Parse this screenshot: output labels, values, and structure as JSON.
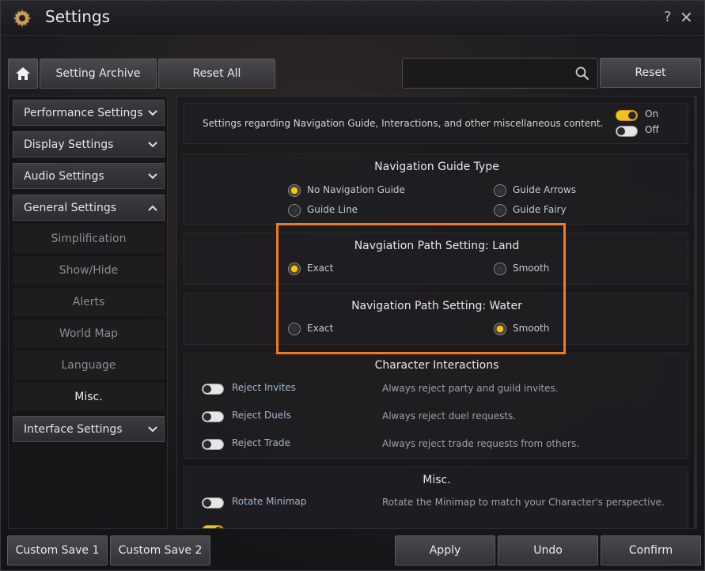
{
  "window": {
    "title": "Settings",
    "help": "?",
    "close": "✕"
  },
  "toolbar": {
    "home_icon": "home-icon",
    "archive": "Setting Archive",
    "reset_all": "Reset All",
    "search_placeholder": "",
    "reset": "Reset"
  },
  "sidebar": {
    "categories": [
      {
        "label": "Performance Settings",
        "expanded": false
      },
      {
        "label": "Display Settings",
        "expanded": false
      },
      {
        "label": "Audio Settings",
        "expanded": false
      },
      {
        "label": "General Settings",
        "expanded": true
      }
    ],
    "general_items": [
      "Simplification",
      "Show/Hide",
      "Alerts",
      "World Map",
      "Language",
      "Misc."
    ],
    "active_item": "Misc.",
    "last_category": {
      "label": "Interface Settings",
      "expanded": false
    }
  },
  "content": {
    "header_desc": "Settings regarding Navigation Guide, Interactions, and other miscellaneous content.",
    "legend_on": "On",
    "legend_off": "Off",
    "nav_guide": {
      "title": "Navigation Guide Type",
      "options": [
        "No Navigation Guide",
        "Guide Line",
        "Guide Arrows",
        "Guide Fairy"
      ],
      "selected": "No Navigation Guide"
    },
    "path_land": {
      "title": "Navgiation Path Setting: Land",
      "options": [
        "Exact",
        "Smooth"
      ],
      "selected": "Exact"
    },
    "path_water": {
      "title": "Navigation Path Setting: Water",
      "options": [
        "Exact",
        "Smooth"
      ],
      "selected": "Smooth"
    },
    "interactions": {
      "title": "Character Interactions",
      "items": [
        {
          "label": "Reject Invites",
          "desc": "Always reject party and guild invites.",
          "on": false
        },
        {
          "label": "Reject Duels",
          "desc": "Always reject duel requests.",
          "on": false
        },
        {
          "label": "Reject Trade",
          "desc": "Always reject trade requests from others.",
          "on": false
        }
      ]
    },
    "misc": {
      "title": "Misc.",
      "items": [
        {
          "label": "Rotate Minimap",
          "desc": "Rotate the Minimap to match your Character's perspective.",
          "on": false
        }
      ]
    }
  },
  "footer": {
    "custom1": "Custom Save 1",
    "custom2": "Custom Save 2",
    "apply": "Apply",
    "undo": "Undo",
    "confirm": "Confirm"
  },
  "colors": {
    "accent": "#f5c518",
    "highlight_box": "#f07a22",
    "toggle_label": "#9fb6cf"
  }
}
